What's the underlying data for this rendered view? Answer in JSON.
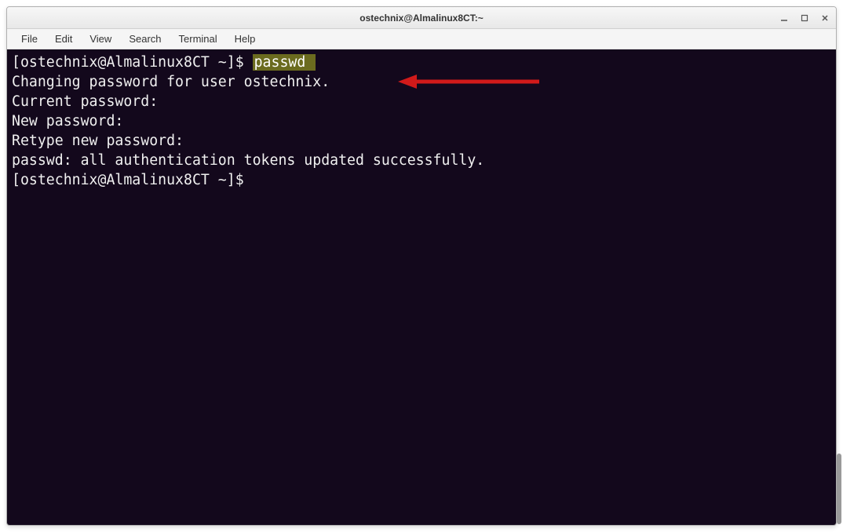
{
  "window": {
    "title": "ostechnix@Almalinux8CT:~"
  },
  "controls": {
    "minimize": "–",
    "maximize": "◻",
    "close": "×"
  },
  "menubar": {
    "file": "File",
    "edit": "Edit",
    "view": "View",
    "search": "Search",
    "terminal": "Terminal",
    "help": "Help"
  },
  "terminal": {
    "prompt1_pre": "[ostechnix@Almalinux8CT ~]$ ",
    "cmd1": "passwd ",
    "line2": "Changing password for user ostechnix.",
    "line3": "Current password: ",
    "line4": "New password: ",
    "line5": "Retype new password: ",
    "line6": "passwd: all authentication tokens updated successfully.",
    "prompt2": "[ostechnix@Almalinux8CT ~]$ "
  },
  "annotation": {
    "arrow_color": "#d11a1a"
  }
}
